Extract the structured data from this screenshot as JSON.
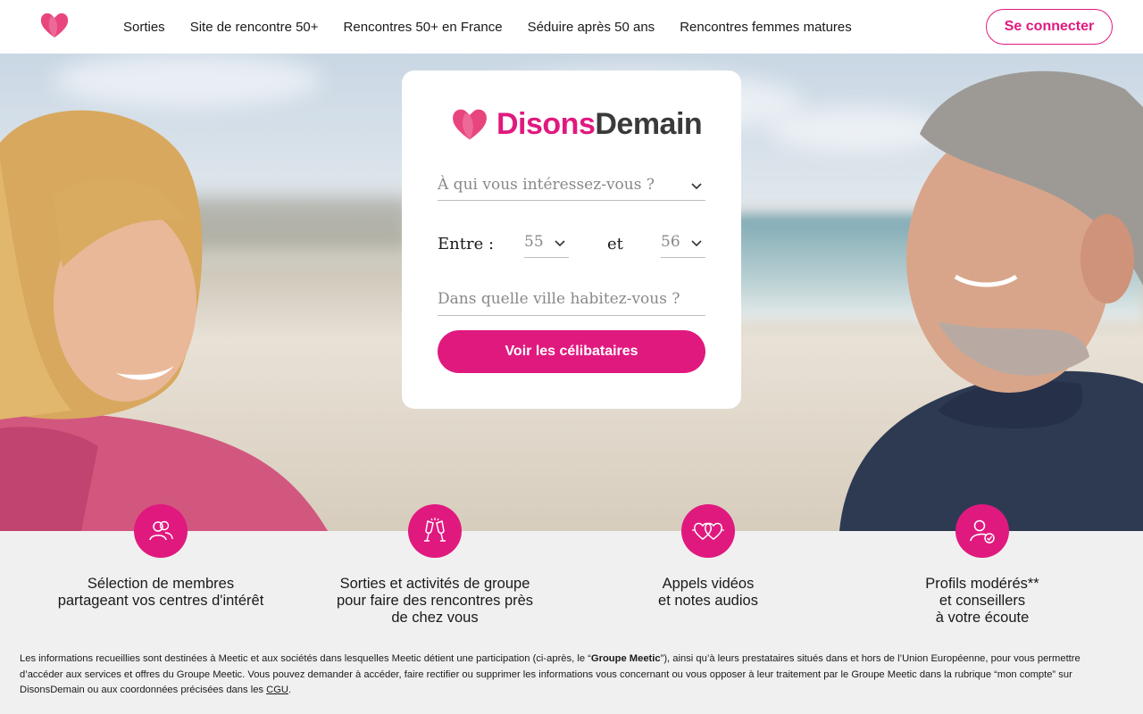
{
  "colors": {
    "accent": "#e0197f",
    "brand_dark": "#3a3a3a",
    "feature_bg": "#f0f0f0"
  },
  "header": {
    "logo_icon": "heart-logo-icon",
    "nav": [
      "Sorties",
      "Site de rencontre 50+",
      "Rencontres 50+ en France",
      "Séduire après 50 ans",
      "Rencontres femmes matures"
    ],
    "login_label": "Se connecter"
  },
  "card": {
    "brand_part1": "Disons",
    "brand_part2": "Demain",
    "interest_placeholder": "À qui vous intéressez-vous ?",
    "entre_label": "Entre :",
    "age_min": "55",
    "et_label": "et",
    "age_max": "56",
    "city_placeholder": "Dans quelle ville habitez-vous ?",
    "cta_label": "Voir les célibataires"
  },
  "features": [
    {
      "icon": "members-icon",
      "text": "Sélection de membres\npartageant vos centres d'intérêt"
    },
    {
      "icon": "champagne-glasses-icon",
      "text": "Sorties et activités de groupe\npour faire des rencontres près\nde chez vous"
    },
    {
      "icon": "video-hearts-icon",
      "text": "Appels vidéos\net notes audios"
    },
    {
      "icon": "verified-profile-icon",
      "text": "Profils modérés**\net conseillers\nà votre écoute"
    }
  ],
  "legal": {
    "part1": "Les informations recueillies sont destinées à Meetic et aux sociétés dans lesquelles Meetic détient une participation (ci-après, le “",
    "bold": "Groupe Meetic",
    "part2": "”), ainsi qu’à leurs prestataires situés dans et hors de l’Union Européenne, pour vous permettre d’accéder aux services et offres du Groupe Meetic. Vous pouvez demander à accéder, faire rectifier ou supprimer les informations vous concernant ou vous opposer à leur traitement par le Groupe Meetic dans la rubrique “mon compte” sur DisonsDemain ou aux coordonnées précisées dans les ",
    "link": "CGU",
    "part3": "."
  }
}
